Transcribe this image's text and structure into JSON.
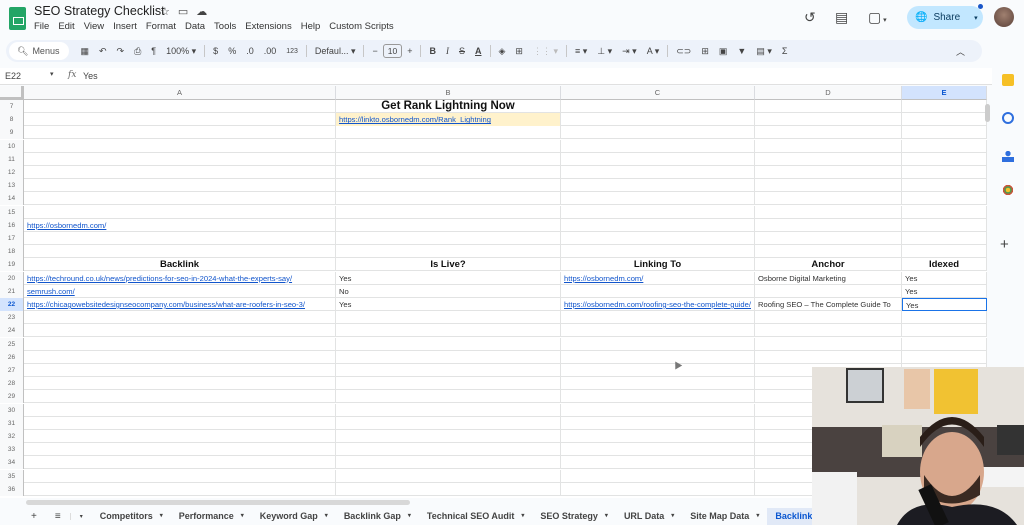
{
  "app": {
    "title": "SEO Strategy Checklist",
    "title_icons": [
      "star-icon",
      "folder-icon",
      "cloud-icon"
    ],
    "menu": [
      "File",
      "Edit",
      "View",
      "Insert",
      "Format",
      "Data",
      "Tools",
      "Extensions",
      "Help",
      "Custom Scripts"
    ],
    "share_label": "Share",
    "accent": "#0b57d0"
  },
  "toolbar": {
    "menus_label": "Menus",
    "zoom": "100%",
    "currency": "$",
    "percent": "%",
    "dec_decrease": ".0",
    "dec_increase": ".00",
    "number_format": "123",
    "font": "Defaul...",
    "minus": "−",
    "font_size": "10",
    "plus": "+",
    "bold": "B",
    "italic": "I",
    "strike": "S",
    "text_color": "A",
    "sum": "Σ"
  },
  "formula_bar": {
    "cell_ref": "E22",
    "fx": "fx",
    "value": "Yes"
  },
  "columns": [
    "A",
    "B",
    "C",
    "D",
    "E"
  ],
  "selected_column": "E",
  "selected_row": "22",
  "rows": [
    {
      "n": "7",
      "a": "",
      "b": "Get Rank Lightning Now",
      "c": "",
      "d": "",
      "e": ""
    },
    {
      "n": "8",
      "a": "",
      "b": "https://linkto.osbornedm.com/Rank_Lightning",
      "c": "",
      "d": "",
      "e": ""
    },
    {
      "n": "9"
    },
    {
      "n": "10"
    },
    {
      "n": "11"
    },
    {
      "n": "12"
    },
    {
      "n": "13"
    },
    {
      "n": "14"
    },
    {
      "n": "15"
    },
    {
      "n": "16",
      "a": "https://osbornedm.com/"
    },
    {
      "n": "17"
    },
    {
      "n": "18"
    },
    {
      "n": "19",
      "a": "Backlink",
      "b": "Is Live?",
      "c": "Linking To",
      "d": "Anchor",
      "e": "Idexed"
    },
    {
      "n": "20",
      "a": "https://techround.co.uk/news/predictions-for-seo-in-2024-what-the-experts-say/",
      "b": "Yes",
      "c": "https://osbornedm.com/",
      "d": "Osborne Digital Marketing",
      "e": "Yes"
    },
    {
      "n": "21",
      "a": "semrush.com/",
      "b": "No",
      "c": "",
      "d": "",
      "e": "Yes"
    },
    {
      "n": "22",
      "a": "https://chicagowebsitedesignseocompany.com/business/what-are-roofers-in-seo-3/",
      "b": "Yes",
      "c": "https://osbornedm.com/roofing-seo-the-complete-guide/",
      "d": "Roofing SEO – The Complete Guide To",
      "e": "Yes"
    },
    {
      "n": "23"
    },
    {
      "n": "24"
    },
    {
      "n": "25"
    },
    {
      "n": "26"
    },
    {
      "n": "27"
    },
    {
      "n": "28"
    },
    {
      "n": "29"
    },
    {
      "n": "30"
    },
    {
      "n": "31"
    },
    {
      "n": "32"
    },
    {
      "n": "33"
    },
    {
      "n": "34"
    },
    {
      "n": "35"
    },
    {
      "n": "36"
    }
  ],
  "sheet_tabs": [
    "Competitors",
    "Performance",
    "Keyword Gap",
    "Backlink Gap",
    "Technical SEO Audit",
    "SEO Strategy",
    "URL Data",
    "Site Map Data",
    "Backlinks"
  ],
  "active_tab": "Backlinks"
}
